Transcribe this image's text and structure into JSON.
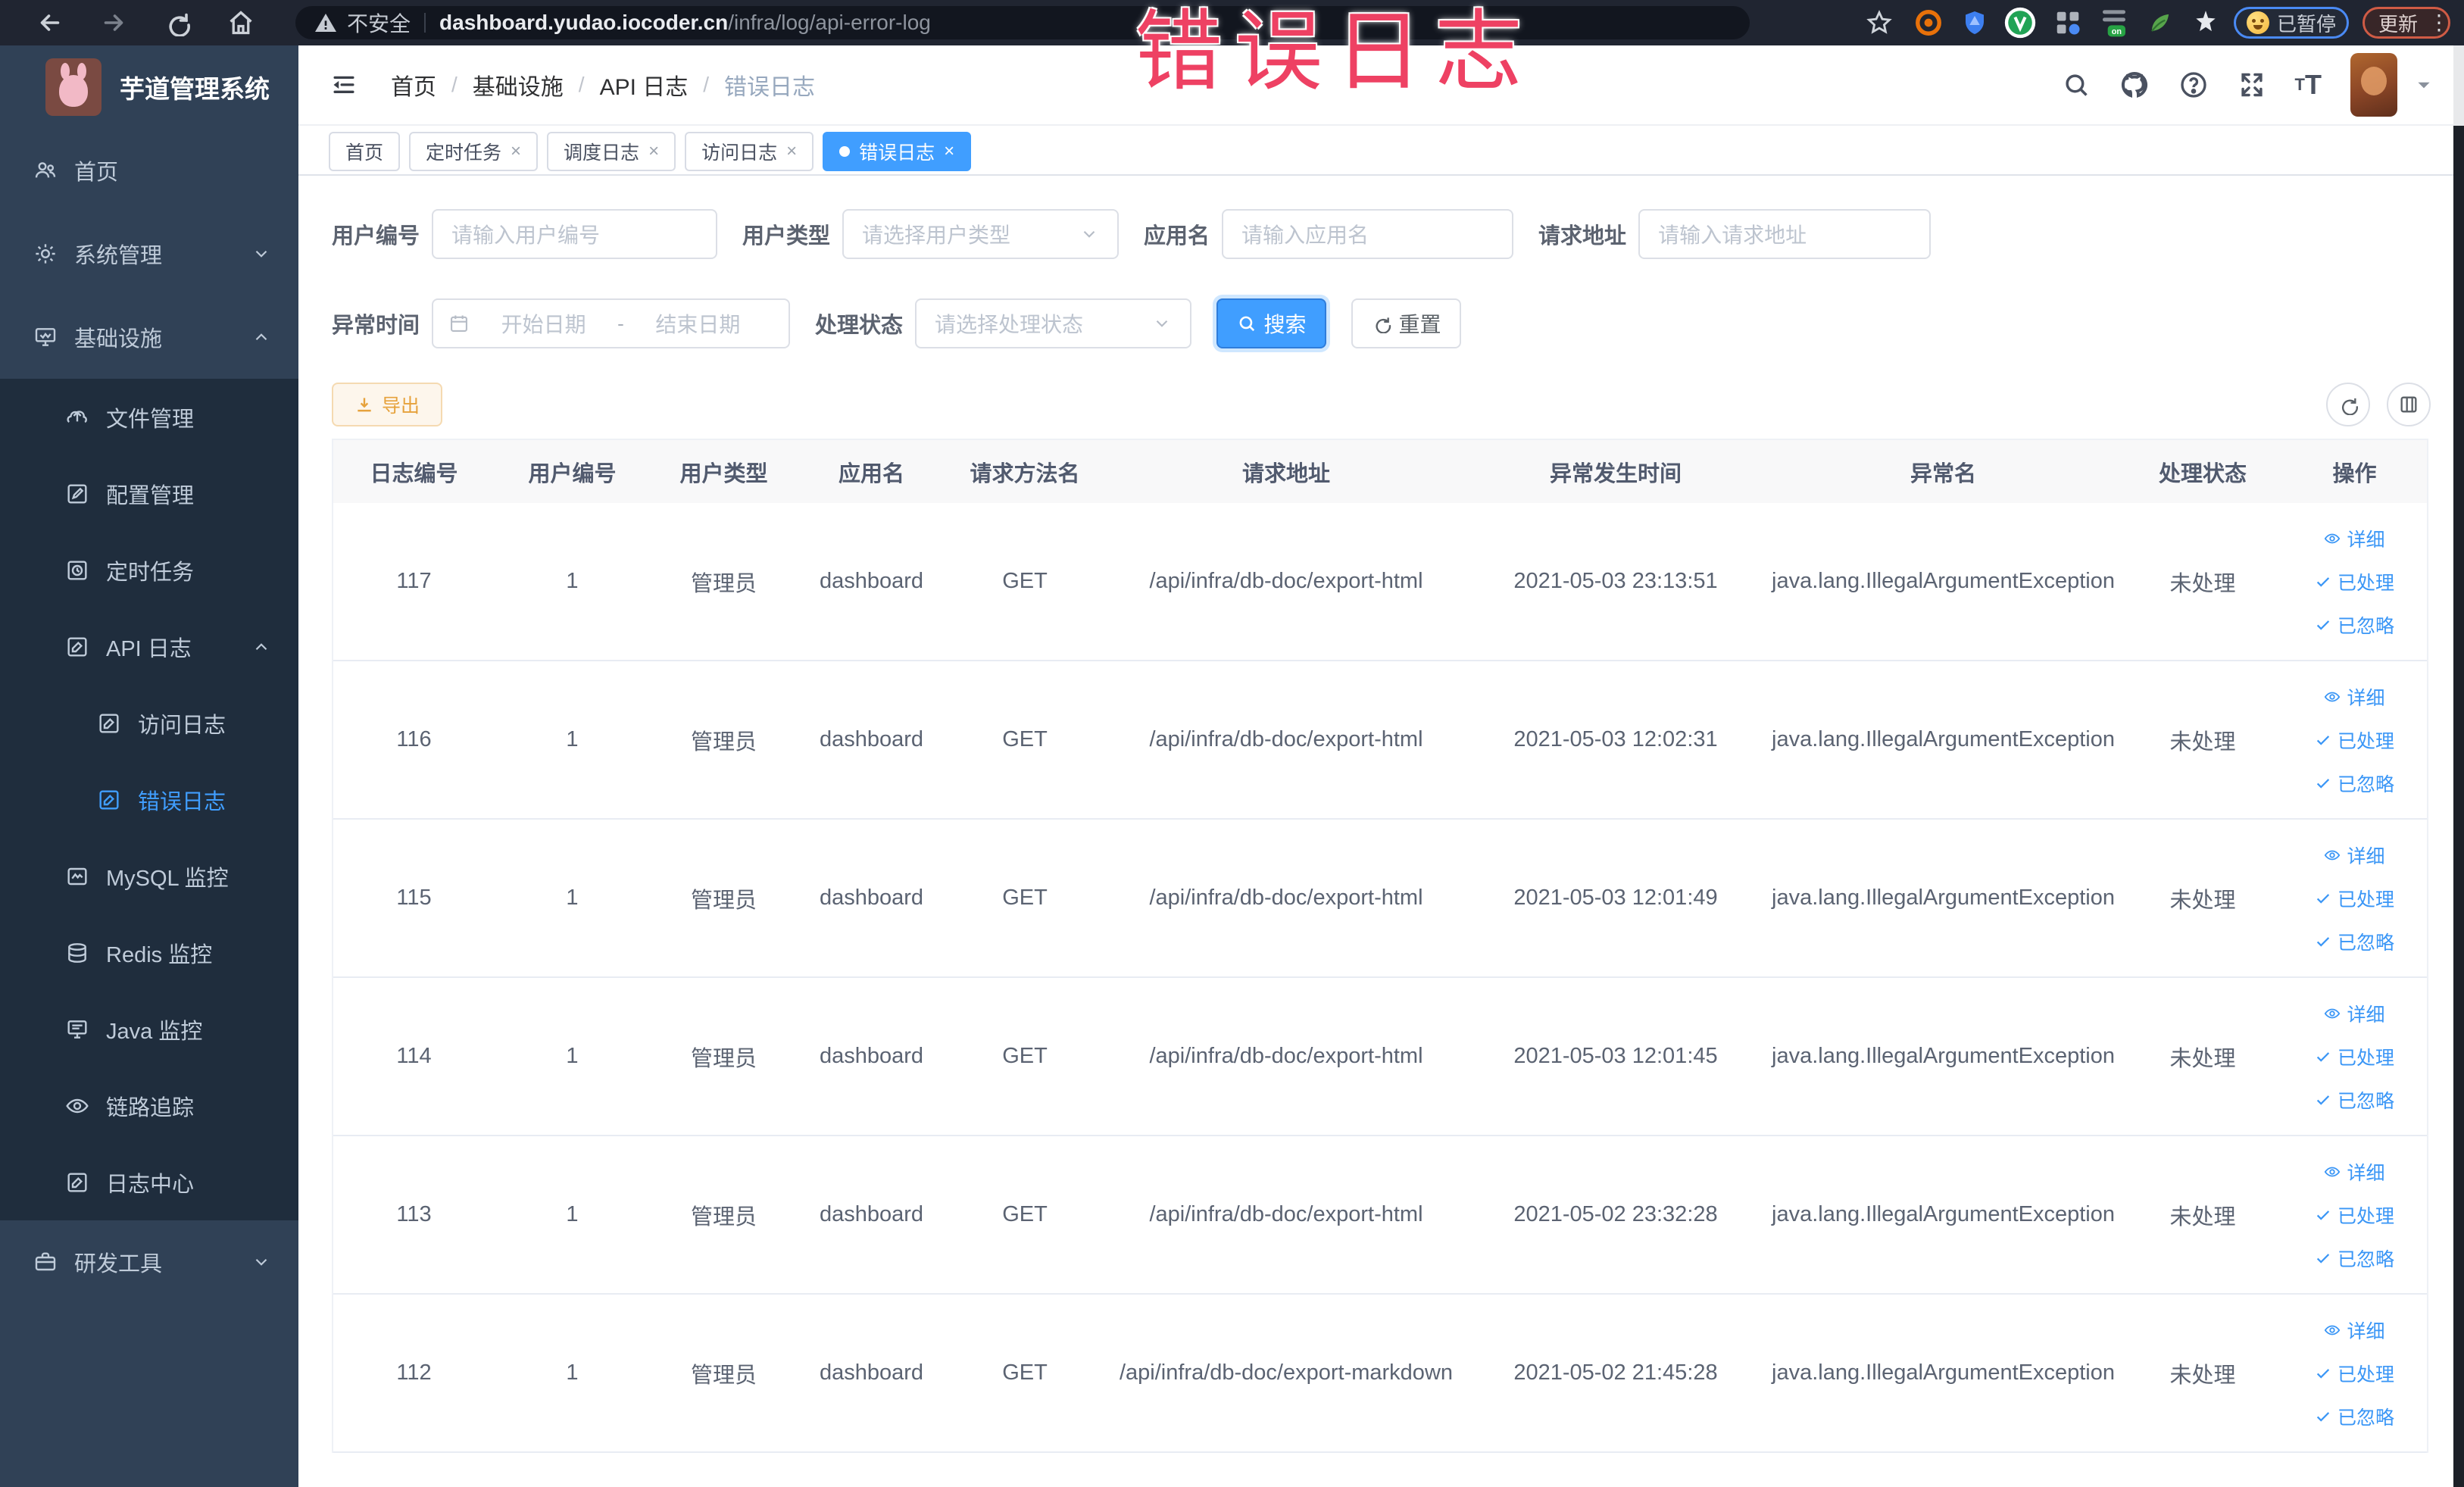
{
  "browser": {
    "security_label": "不安全",
    "url_host": "dashboard.yudao.iocoder.cn",
    "url_path": "/infra/log/api-error-log",
    "paused_badge": "已暂停",
    "update_badge": "更新"
  },
  "annotation": {
    "text": "错误日志",
    "color": "#ee4163"
  },
  "sidebar": {
    "logo_title": "芋道管理系统",
    "items": [
      {
        "label": "首页"
      },
      {
        "label": "系统管理"
      },
      {
        "label": "基础设施"
      },
      {
        "label": "文件管理"
      },
      {
        "label": "配置管理"
      },
      {
        "label": "定时任务"
      },
      {
        "label": "API 日志"
      },
      {
        "label": "访问日志"
      },
      {
        "label": "错误日志"
      },
      {
        "label": "MySQL 监控"
      },
      {
        "label": "Redis 监控"
      },
      {
        "label": "Java 监控"
      },
      {
        "label": "链路追踪"
      },
      {
        "label": "日志中心"
      },
      {
        "label": "研发工具"
      }
    ]
  },
  "header": {
    "breadcrumb": [
      "首页",
      "基础设施",
      "API 日志",
      "错误日志"
    ]
  },
  "tabs": [
    {
      "label": "首页"
    },
    {
      "label": "定时任务"
    },
    {
      "label": "调度日志"
    },
    {
      "label": "访问日志"
    },
    {
      "label": "错误日志"
    }
  ],
  "filters": {
    "user_id_label": "用户编号",
    "user_id_placeholder": "请输入用户编号",
    "user_type_label": "用户类型",
    "user_type_placeholder": "请选择用户类型",
    "app_name_label": "应用名",
    "app_name_placeholder": "请输入应用名",
    "request_url_label": "请求地址",
    "request_url_placeholder": "请输入请求地址",
    "exception_time_label": "异常时间",
    "date_start_placeholder": "开始日期",
    "date_separator": "-",
    "date_end_placeholder": "结束日期",
    "status_label": "处理状态",
    "status_placeholder": "请选择处理状态",
    "search_label": "搜索",
    "reset_label": "重置"
  },
  "toolbar": {
    "export_label": "导出"
  },
  "table": {
    "columns": [
      "日志编号",
      "用户编号",
      "用户类型",
      "应用名",
      "请求方法名",
      "请求地址",
      "异常发生时间",
      "异常名",
      "处理状态",
      "操作"
    ],
    "action_labels": [
      "详细",
      "已处理",
      "已忽略"
    ],
    "rows": [
      {
        "id": "117",
        "user_id": "1",
        "user_type": "管理员",
        "app": "dashboard",
        "method": "GET",
        "url": "/api/infra/db-doc/export-html",
        "time": "2021-05-03 23:13:51",
        "exception": "java.lang.IllegalArgumentException",
        "status": "未处理"
      },
      {
        "id": "116",
        "user_id": "1",
        "user_type": "管理员",
        "app": "dashboard",
        "method": "GET",
        "url": "/api/infra/db-doc/export-html",
        "time": "2021-05-03 12:02:31",
        "exception": "java.lang.IllegalArgumentException",
        "status": "未处理"
      },
      {
        "id": "115",
        "user_id": "1",
        "user_type": "管理员",
        "app": "dashboard",
        "method": "GET",
        "url": "/api/infra/db-doc/export-html",
        "time": "2021-05-03 12:01:49",
        "exception": "java.lang.IllegalArgumentException",
        "status": "未处理"
      },
      {
        "id": "114",
        "user_id": "1",
        "user_type": "管理员",
        "app": "dashboard",
        "method": "GET",
        "url": "/api/infra/db-doc/export-html",
        "time": "2021-05-03 12:01:45",
        "exception": "java.lang.IllegalArgumentException",
        "status": "未处理"
      },
      {
        "id": "113",
        "user_id": "1",
        "user_type": "管理员",
        "app": "dashboard",
        "method": "GET",
        "url": "/api/infra/db-doc/export-html",
        "time": "2021-05-02 23:32:28",
        "exception": "java.lang.IllegalArgumentException",
        "status": "未处理"
      },
      {
        "id": "112",
        "user_id": "1",
        "user_type": "管理员",
        "app": "dashboard",
        "method": "GET",
        "url": "/api/infra/db-doc/export-markdown",
        "time": "2021-05-02 21:45:28",
        "exception": "java.lang.IllegalArgumentException",
        "status": "未处理"
      }
    ]
  }
}
